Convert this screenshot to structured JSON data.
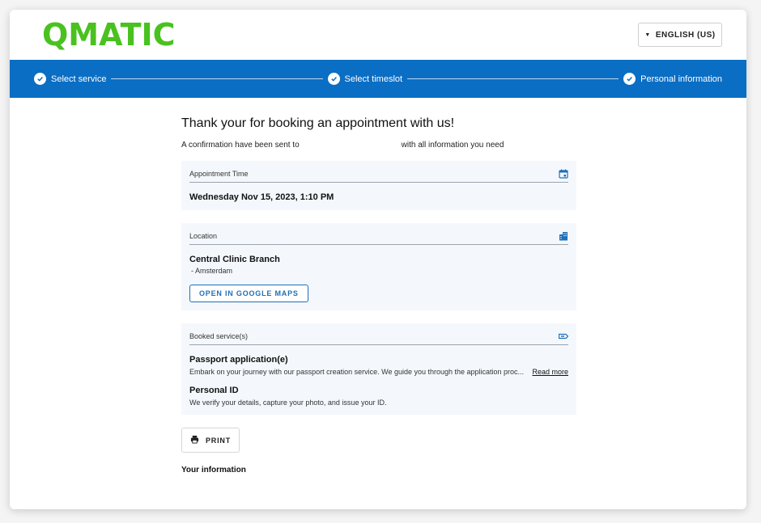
{
  "brand": {
    "logo_text": "QMATIC",
    "logo_color": "#49c21f",
    "accent": "#0a6ec4"
  },
  "header": {
    "language_label": "ENGLISH (US)"
  },
  "stepper": {
    "steps": [
      {
        "label": "Select service",
        "icon": "check-circle-icon"
      },
      {
        "label": "Select timeslot",
        "icon": "check-circle-icon"
      },
      {
        "label": "Personal information",
        "icon": "check-circle-icon"
      }
    ]
  },
  "main": {
    "title": "Thank your for booking an appointment with us!",
    "confirm_prefix": "A confirmation have been sent to",
    "confirm_suffix": "with all information you need",
    "appointment": {
      "label": "Appointment Time",
      "icon": "calendar-icon",
      "value": "Wednesday Nov 15, 2023, 1:10 PM"
    },
    "location": {
      "label": "Location",
      "icon": "building-icon",
      "name": "Central Clinic Branch",
      "city": "- Amsterdam",
      "maps_button": "OPEN IN GOOGLE MAPS"
    },
    "services": {
      "label": "Booked service(s)",
      "icon": "ticket-icon",
      "items": [
        {
          "title": "Passport application(e)",
          "desc": "Embark on your journey with our passport creation service. We guide you through the application proc...",
          "read_more": "Read more"
        },
        {
          "title": "Personal ID",
          "desc": "We verify your details, capture your photo, and issue your ID."
        }
      ]
    },
    "print_label": "PRINT",
    "your_info": "Your information"
  }
}
